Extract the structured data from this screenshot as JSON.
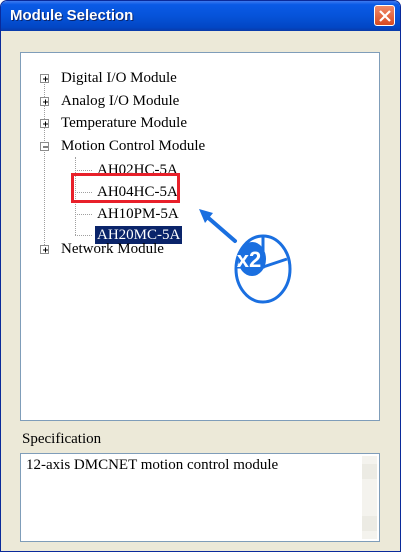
{
  "window": {
    "title": "Module Selection"
  },
  "tree": {
    "items": [
      {
        "label": "Digital I/O Module",
        "expander": "+"
      },
      {
        "label": "Analog I/O Module",
        "expander": "+"
      },
      {
        "label": "Temperature Module",
        "expander": "+"
      },
      {
        "label": "Motion Control Module",
        "expander": "−"
      },
      {
        "label": "AH02HC-5A"
      },
      {
        "label": "AH04HC-5A"
      },
      {
        "label": "AH10PM-5A"
      },
      {
        "label": "AH20MC-5A",
        "selected": true
      },
      {
        "label": "Network Module",
        "expander": "+"
      }
    ]
  },
  "callout": {
    "text": "x2",
    "icon": "mouse-double-click-icon",
    "color": "#1a6fe0",
    "highlight_color": "#e8202a"
  },
  "specification": {
    "label": "Specification",
    "text": "12-axis DMCNET motion control module"
  }
}
